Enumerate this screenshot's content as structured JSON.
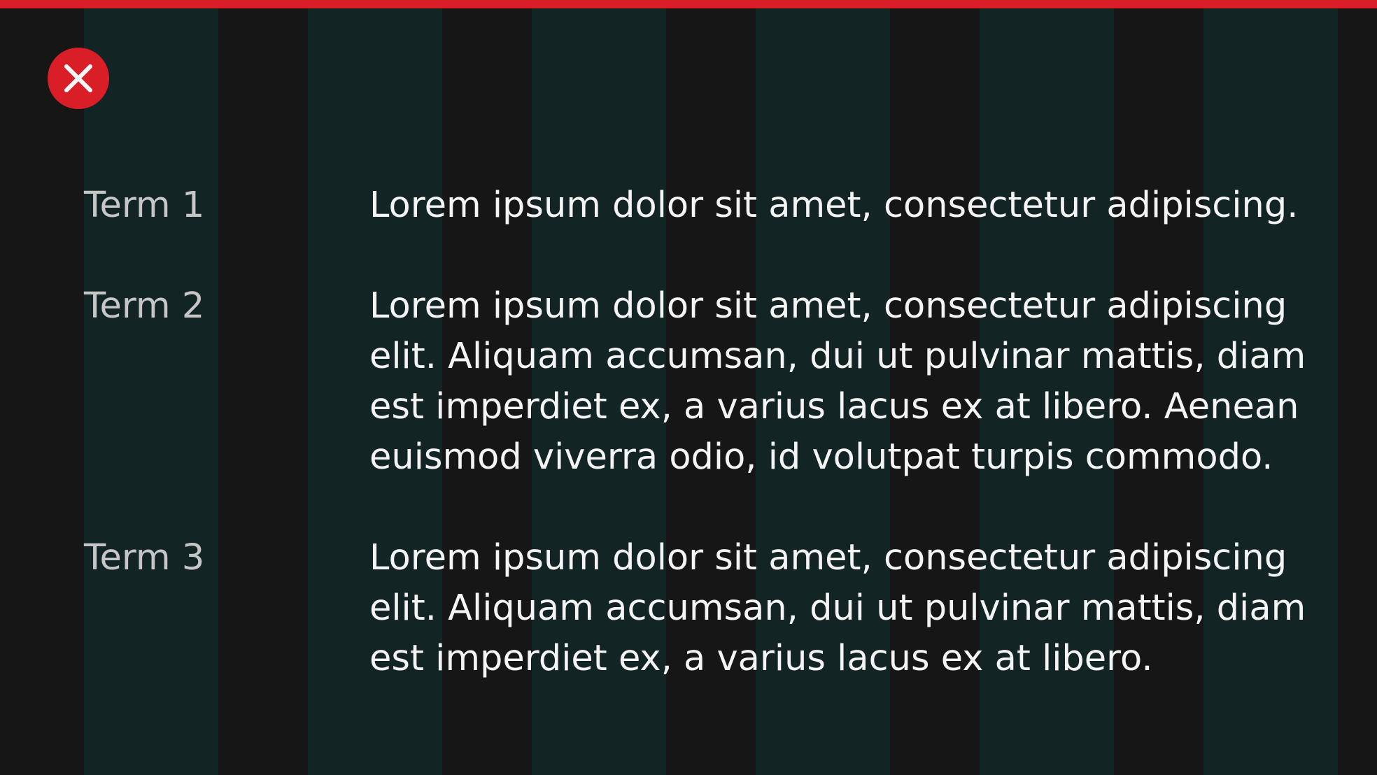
{
  "theme": {
    "accent_color": "#da1e28",
    "background_color": "#161616",
    "grid_column_color": "#132424",
    "term_color": "#c6c6c6",
    "description_color": "#f4f4f4"
  },
  "status_icon": {
    "name": "error-close-icon",
    "meaning": "incorrect"
  },
  "definition_list": [
    {
      "term": "Term 1",
      "description": "Lorem ipsum dolor sit amet, consectetur adipiscing."
    },
    {
      "term": "Term 2",
      "description": "Lorem ipsum dolor sit amet, consectetur adipiscing elit. Aliquam accumsan, dui ut pulvinar mattis, diam est imperdiet ex, a varius lacus ex at libero. Aenean euismod viverra odio, id volutpat turpis commodo."
    },
    {
      "term": "Term 3",
      "description": "Lorem ipsum dolor sit amet, consectetur adipiscing elit. Aliquam accumsan, dui ut pulvinar mattis, diam est imperdiet ex, a varius lacus ex at libero."
    }
  ]
}
